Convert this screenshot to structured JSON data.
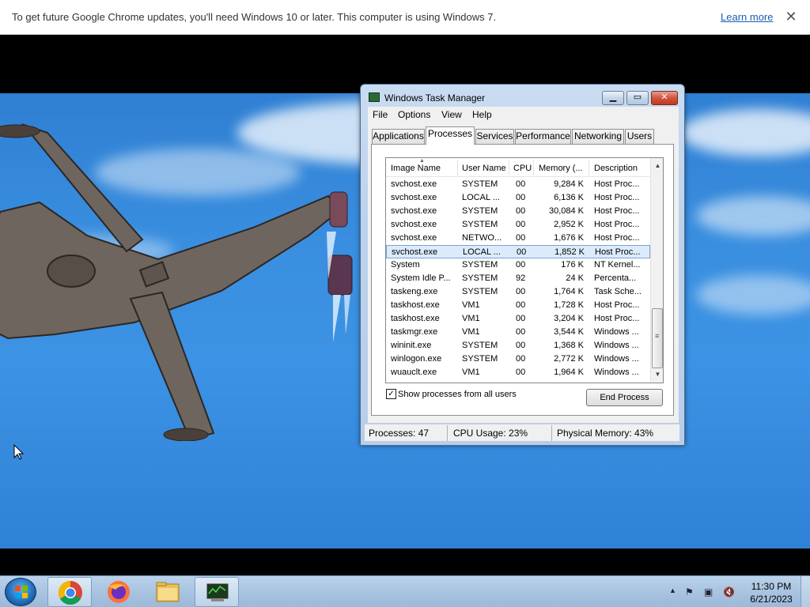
{
  "infobar": {
    "message": "To get future Google Chrome updates, you'll need Windows 10 or later. This computer is using Windows 7.",
    "learn_more": "Learn more",
    "close": "✕"
  },
  "task_manager": {
    "title": "Windows Task Manager",
    "menu": [
      "File",
      "Options",
      "View",
      "Help"
    ],
    "tabs": [
      "Applications",
      "Processes",
      "Services",
      "Performance",
      "Networking",
      "Users"
    ],
    "active_tab": "Processes",
    "columns": [
      "Image Name",
      "User Name",
      "CPU",
      "Memory (...",
      "Description"
    ],
    "processes": [
      {
        "name": "svchost.exe",
        "user": "SYSTEM",
        "cpu": "00",
        "memory": "9,284 K",
        "description": "Host Proc..."
      },
      {
        "name": "svchost.exe",
        "user": "LOCAL ...",
        "cpu": "00",
        "memory": "6,136 K",
        "description": "Host Proc..."
      },
      {
        "name": "svchost.exe",
        "user": "SYSTEM",
        "cpu": "00",
        "memory": "30,084 K",
        "description": "Host Proc..."
      },
      {
        "name": "svchost.exe",
        "user": "SYSTEM",
        "cpu": "00",
        "memory": "2,952 K",
        "description": "Host Proc..."
      },
      {
        "name": "svchost.exe",
        "user": "NETWO...",
        "cpu": "00",
        "memory": "1,676 K",
        "description": "Host Proc..."
      },
      {
        "name": "svchost.exe",
        "user": "LOCAL ...",
        "cpu": "00",
        "memory": "1,852 K",
        "description": "Host Proc...",
        "selected": true
      },
      {
        "name": "System",
        "user": "SYSTEM",
        "cpu": "00",
        "memory": "176 K",
        "description": "NT Kernel..."
      },
      {
        "name": "System Idle P...",
        "user": "SYSTEM",
        "cpu": "92",
        "memory": "24 K",
        "description": "Percenta..."
      },
      {
        "name": "taskeng.exe",
        "user": "SYSTEM",
        "cpu": "00",
        "memory": "1,764 K",
        "description": "Task Sche..."
      },
      {
        "name": "taskhost.exe",
        "user": "VM1",
        "cpu": "00",
        "memory": "1,728 K",
        "description": "Host Proc..."
      },
      {
        "name": "taskhost.exe",
        "user": "VM1",
        "cpu": "00",
        "memory": "3,204 K",
        "description": "Host Proc..."
      },
      {
        "name": "taskmgr.exe",
        "user": "VM1",
        "cpu": "00",
        "memory": "3,544 K",
        "description": "Windows ..."
      },
      {
        "name": "wininit.exe",
        "user": "SYSTEM",
        "cpu": "00",
        "memory": "1,368 K",
        "description": "Windows ..."
      },
      {
        "name": "winlogon.exe",
        "user": "SYSTEM",
        "cpu": "00",
        "memory": "2,772 K",
        "description": "Windows ..."
      },
      {
        "name": "wuauclt.exe",
        "user": "VM1",
        "cpu": "00",
        "memory": "1,964 K",
        "description": "Windows ..."
      }
    ],
    "show_all_label": "Show processes from all users",
    "show_all_checked": true,
    "end_process": "End Process",
    "status": {
      "processes": "Processes: 47",
      "cpu": "CPU Usage: 23%",
      "memory": "Physical Memory: 43%"
    }
  },
  "taskbar": {
    "apps": [
      "start-orb-icon",
      "chrome-icon",
      "firefox-icon",
      "explorer-folder-icon",
      "task-manager-icon"
    ],
    "time": "11:30 PM",
    "date": "6/21/2023"
  }
}
